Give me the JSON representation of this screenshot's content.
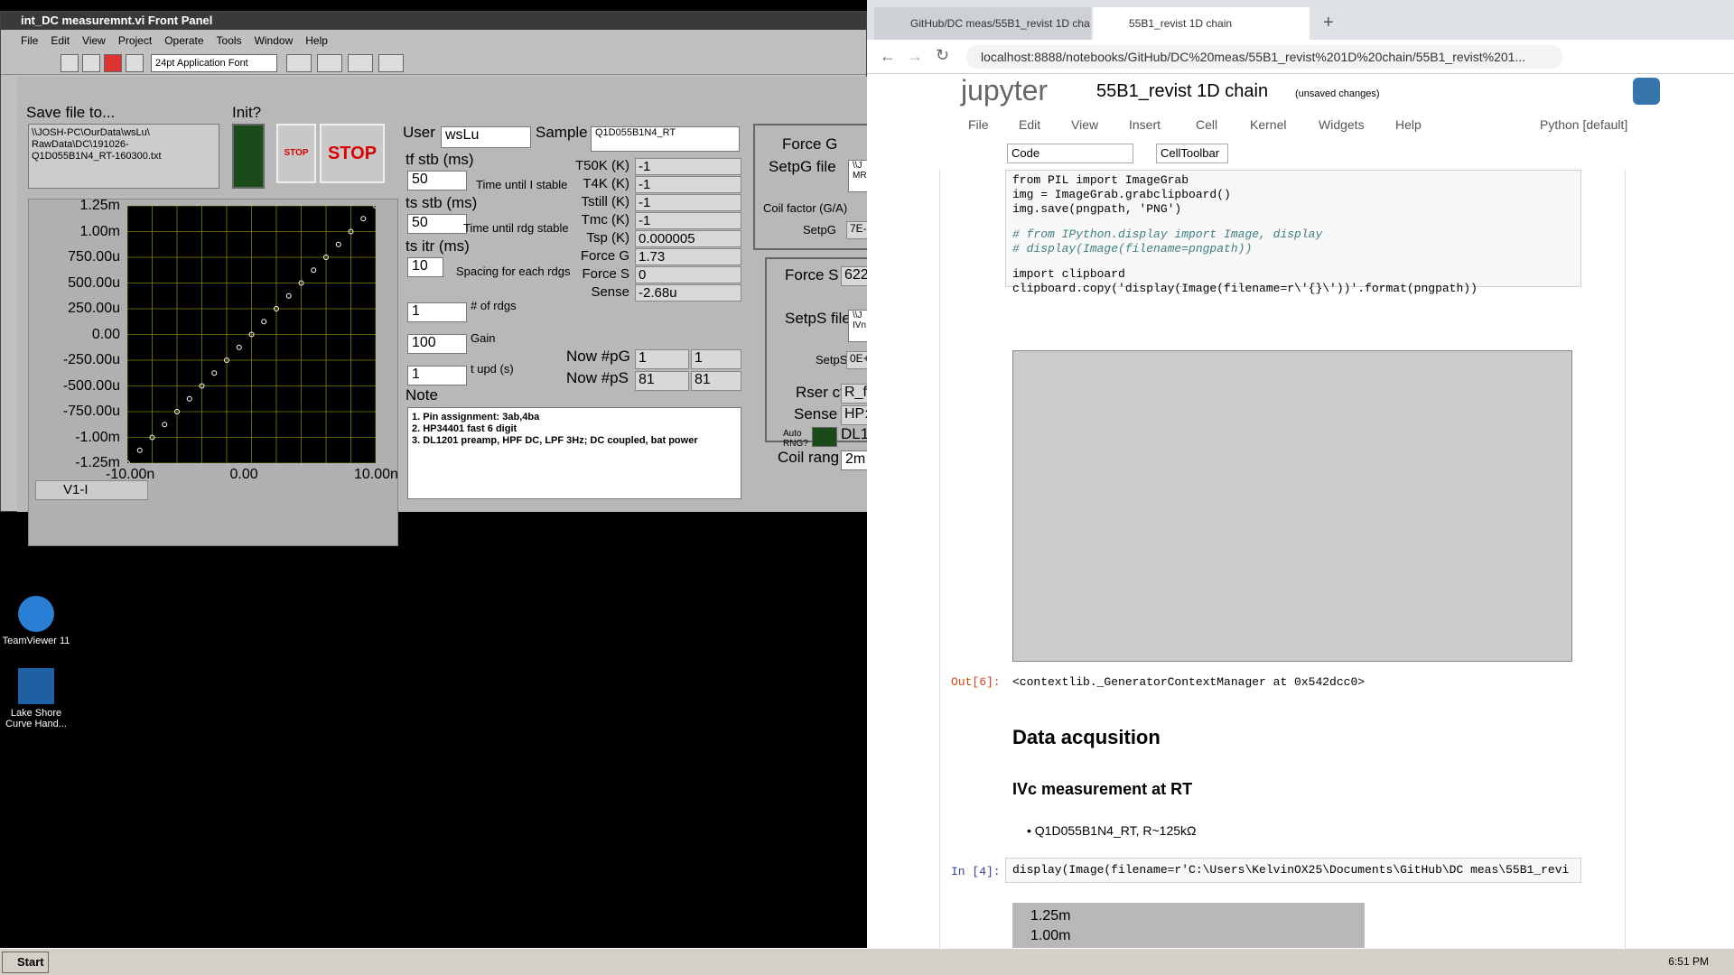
{
  "desktop": {
    "icons": [
      {
        "label": "TeamViewer 11"
      },
      {
        "label": "Lake Shore Curve Hand..."
      }
    ]
  },
  "labview": {
    "title": "int_DC measuremnt.vi Front Panel",
    "menu": [
      "File",
      "Edit",
      "View",
      "Project",
      "Operate",
      "Tools",
      "Window",
      "Help"
    ],
    "font_select": "24pt Application Font",
    "save_label": "Save file to...",
    "save_path": "\\\\JOSH-PC\\OurData\\wsLu\\\nRawData\\DC\\191026-\nQ1D055B1N4_RT-160300.txt",
    "init_label": "Init?",
    "stop_small": "STOP",
    "stop_big": "STOP",
    "user_label": "User",
    "user": "wsLu",
    "sample_label": "Sample",
    "sample": "Q1D055B1N4_RT",
    "tf_label": "tf stb (ms)",
    "tf": "50",
    "tf_desc": "Time until I stable",
    "ts_label": "ts stb (ms)",
    "ts": "50",
    "ts_desc": "Time until rdg stable",
    "titr_label": "ts itr (ms)",
    "titr": "10",
    "titr_desc": "Spacing for each rdgs",
    "nrdg": "1",
    "nrdg_desc": "# of rdgs",
    "gain": "100",
    "gain_desc": "Gain",
    "tupd": "1",
    "tupd_desc": "t upd (s)",
    "readouts": [
      {
        "label": "T50K (K)",
        "value": "-1"
      },
      {
        "label": "T4K (K)",
        "value": "-1"
      },
      {
        "label": "Tstill (K)",
        "value": "-1"
      },
      {
        "label": "Tmc (K)",
        "value": "-1"
      },
      {
        "label": "Tsp (K)",
        "value": "0.000005"
      },
      {
        "label": "Force G",
        "value": "1.73"
      },
      {
        "label": "Force S",
        "value": "0"
      },
      {
        "label": "Sense",
        "value": "-2.68u"
      }
    ],
    "nowpG_label": "Now #pG",
    "nowpG": [
      "1",
      "1"
    ],
    "nowpS_label": "Now #pS",
    "nowpS": [
      "81",
      "81"
    ],
    "note_label": "Note",
    "note": [
      "1. Pin assignment: 3ab,4ba",
      "2. HP34401 fast 6 digit",
      "3. DL1201 preamp, HPF DC, LPF 3Hz; DC coupled, bat power"
    ],
    "graph_selector": "V1-I",
    "right": {
      "forceG": "Force G",
      "setpG": "SetpG file",
      "setpG_val": "\\\\J\nMR",
      "coil": "Coil factor (G/A)",
      "setpG2": "SetpG",
      "setpG2_val": "7E-",
      "forceS": "Force S",
      "forceS_val": "622",
      "setpS": "SetpS file",
      "setpS_val": "\\\\J\nIVn",
      "setpS2": "SetpS",
      "setpS2_val": "0E+",
      "rser": "Rser cfg",
      "rser_val": "R_f",
      "sense": "Sense",
      "sense_val": "HP:",
      "auto": "Auto RNG?",
      "dl": "DL1",
      "coilr": "Coil rang",
      "coilr_val": "2m"
    }
  },
  "chart_data": {
    "type": "scatter",
    "x": [
      -10.0,
      -9.0,
      -8.0,
      -7.0,
      -6.0,
      -5.0,
      -4.0,
      -3.0,
      -2.0,
      -1.0,
      0.0,
      1.0,
      2.0,
      3.0,
      4.0,
      5.0,
      6.0,
      7.0,
      8.0,
      9.0,
      10.0
    ],
    "y": [
      -1.25,
      -1.125,
      -1.0,
      -0.875,
      -0.75,
      -0.625,
      -0.5,
      -0.375,
      -0.25,
      -0.125,
      0.0,
      0.125,
      0.25,
      0.375,
      0.5,
      0.625,
      0.75,
      0.875,
      1.0,
      1.125,
      1.25
    ],
    "xlim": [
      -10,
      10
    ],
    "ylim": [
      -1.25,
      1.25
    ],
    "xticks": [
      "-10.00n",
      "0.00",
      "10.00n"
    ],
    "yticks": [
      "1.25m",
      "1.00m",
      "750.00u",
      "500.00u",
      "250.00u",
      "0.00",
      "-250.00u",
      "-500.00u",
      "-750.00u",
      "-1.00m",
      "-1.25m"
    ],
    "grid": true,
    "colors": {
      "bg": "#000000",
      "grid": "#808000",
      "line": "#ffffff"
    }
  },
  "browser": {
    "tabs": [
      {
        "label": "GitHub/DC meas/55B1_revist 1D cha"
      },
      {
        "label": "55B1_revist 1D chain"
      }
    ],
    "url": "localhost:8888/notebooks/GitHub/DC%20meas/55B1_revist%201D%20chain/55B1_revist%201...",
    "jupyter_logo": "jupyter",
    "nb_title": "55B1_revist 1D chain",
    "unsaved": "(unsaved changes)",
    "menu": [
      "File",
      "Edit",
      "View",
      "Insert",
      "Cell",
      "Kernel",
      "Widgets",
      "Help"
    ],
    "kernel": "Python [default]",
    "celltype": "Code",
    "celltoolbar": "CellToolbar",
    "code1": [
      [
        "kw",
        "from"
      ],
      [
        "",
        "PIL"
      ],
      [
        "kw",
        "import"
      ],
      [
        "",
        "ImageGrab"
      ]
    ],
    "code_lines": {
      "l1": "from PIL import ImageGrab",
      "l2": "img = ImageGrab.grabclipboard()",
      "l3": "img.save(pngpath, 'PNG')",
      "l4": "# from IPython.display import Image, display",
      "l5": "# display(Image(filename=pngpath))",
      "l6": "import clipboard",
      "l7": "clipboard.copy('display(Image(filename=r\\'{}\\'))'.format(pngpath))"
    },
    "out_prompt": "Out[6]:",
    "out_text": "<contextlib._GeneratorContextManager at 0x542dcc0>",
    "h_acq": "Data acqusition",
    "h_ivc": "IVc measurement at RT",
    "bullet": "Q1D055B1N4_RT, R~125kΩ",
    "in_prompt": "In [4]:",
    "in_code": "display(Image(filename=r'C:\\Users\\KelvinOX25\\Documents\\GitHub\\DC meas\\55B1_revi",
    "thumb_ticks": [
      "1.25m",
      "1.00m"
    ]
  },
  "taskbar": {
    "start": "Start",
    "time": "6:51 PM"
  }
}
